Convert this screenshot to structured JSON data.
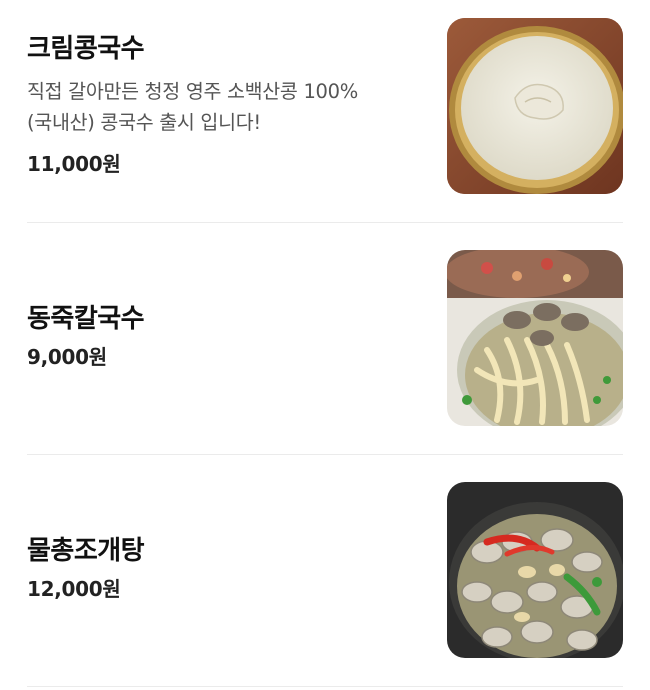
{
  "menu": {
    "items": [
      {
        "name": "크림콩국수",
        "description_line1": "직접 갈아만든 청정 영주 소백산콩 100%",
        "description_line2": "(국내산) 콩국수 출시 입니다!",
        "price": "11,000원"
      },
      {
        "name": "동죽칼국수",
        "price": "9,000원"
      },
      {
        "name": "물총조개탕",
        "price": "12,000원"
      }
    ]
  },
  "colors": {
    "text_primary": "#111111",
    "text_secondary": "#555555",
    "divider": "#ebebeb"
  }
}
